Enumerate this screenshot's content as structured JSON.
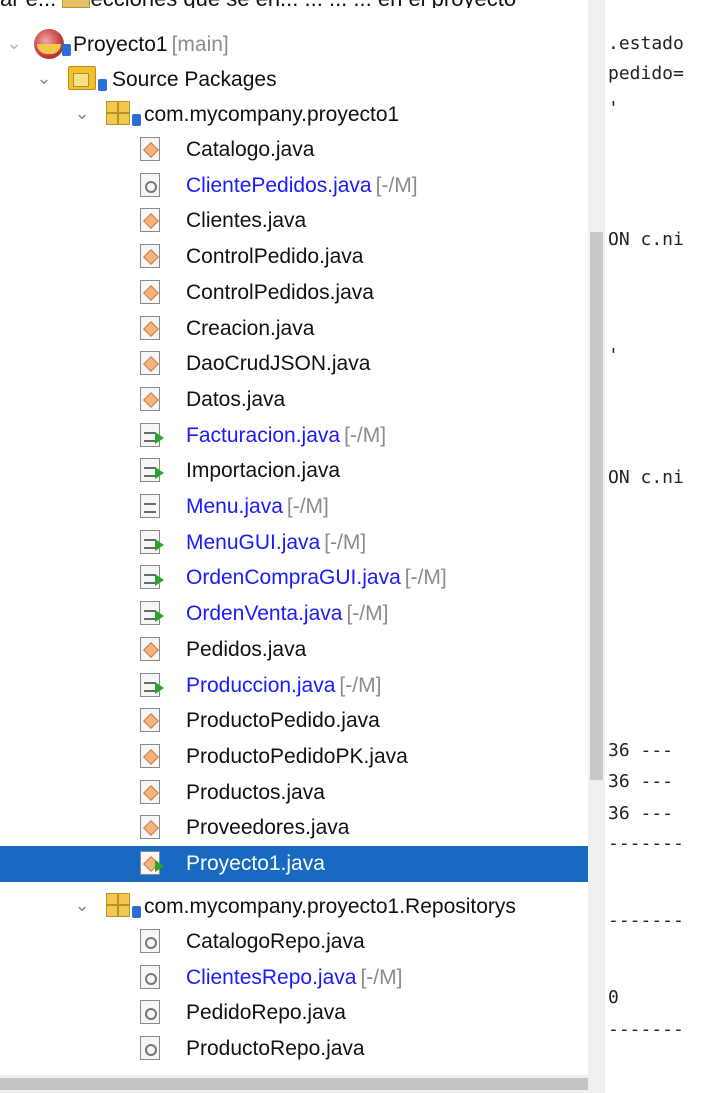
{
  "top_caption": "ar e... colecciones que se en... ... ... ... en el proyecto",
  "project": {
    "name": "Proyecto1",
    "branch": "[main]"
  },
  "source_packages": {
    "label": "Source Packages"
  },
  "packages": [
    {
      "name": "com.mycompany.proyecto1",
      "files": [
        {
          "name": "Catalogo.java",
          "icon": "form-icon"
        },
        {
          "name": "ClientePedidos.java",
          "icon": "interface-icon",
          "modified": true,
          "suffix": "[-/M]"
        },
        {
          "name": "Clientes.java",
          "icon": "form-icon"
        },
        {
          "name": "ControlPedido.java",
          "icon": "form-icon"
        },
        {
          "name": "ControlPedidos.java",
          "icon": "form-icon"
        },
        {
          "name": "Creacion.java",
          "icon": "form-icon"
        },
        {
          "name": "DaoCrudJSON.java",
          "icon": "form-icon"
        },
        {
          "name": "Datos.java",
          "icon": "form-icon"
        },
        {
          "name": "Facturacion.java",
          "icon": "runnable-class-icon",
          "modified": true,
          "suffix": "[-/M]"
        },
        {
          "name": "Importacion.java",
          "icon": "runnable-class-icon"
        },
        {
          "name": "Menu.java",
          "icon": "class-icon",
          "modified": true,
          "suffix": "[-/M]"
        },
        {
          "name": "MenuGUI.java",
          "icon": "runnable-class-icon",
          "modified": true,
          "suffix": "[-/M]"
        },
        {
          "name": "OrdenCompraGUI.java",
          "icon": "runnable-class-icon",
          "modified": true,
          "suffix": "[-/M]"
        },
        {
          "name": "OrdenVenta.java",
          "icon": "runnable-class-icon",
          "modified": true,
          "suffix": "[-/M]"
        },
        {
          "name": "Pedidos.java",
          "icon": "form-icon"
        },
        {
          "name": "Produccion.java",
          "icon": "runnable-class-icon",
          "modified": true,
          "suffix": "[-/M]"
        },
        {
          "name": "ProductoPedido.java",
          "icon": "form-icon"
        },
        {
          "name": "ProductoPedidoPK.java",
          "icon": "form-icon"
        },
        {
          "name": "Productos.java",
          "icon": "form-icon"
        },
        {
          "name": "Proveedores.java",
          "icon": "form-icon"
        },
        {
          "name": "Proyecto1.java",
          "icon": "runnable-form-icon",
          "selected": true
        }
      ]
    },
    {
      "name": "com.mycompany.proyecto1.Repositorys",
      "files": [
        {
          "name": "CatalogoRepo.java",
          "icon": "interface-icon"
        },
        {
          "name": "ClientesRepo.java",
          "icon": "interface-icon",
          "modified": true,
          "suffix": "[-/M]"
        },
        {
          "name": "PedidoRepo.java",
          "icon": "interface-icon"
        },
        {
          "name": "ProductoRepo.java",
          "icon": "interface-icon"
        }
      ]
    }
  ],
  "editor_lines": [
    ".estado",
    "pedido=",
    "'",
    "ON c.ni",
    "'",
    "ON c.ni",
    "36 ---",
    "36 ---",
    "36 ---",
    "-------",
    "-------",
    "0",
    "-------"
  ],
  "colors": {
    "selection": "#1769c2",
    "modified_text": "#1a1aff",
    "suffix_text": "#8c8c8c"
  }
}
